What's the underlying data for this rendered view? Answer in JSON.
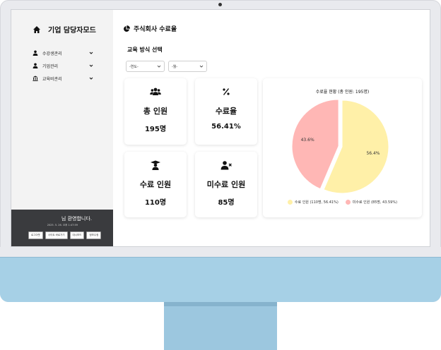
{
  "sidebar": {
    "title": "기업 담당자모드",
    "items": [
      {
        "label": "수강생관리",
        "icon": "user-icon"
      },
      {
        "label": "기업관리",
        "icon": "user-icon"
      },
      {
        "label": "교육비관리",
        "icon": "bank-icon"
      }
    ],
    "welcome": "님 환영합니다.",
    "datetime": "2025. 5. 26. 오후 1:47:59",
    "buttons": [
      "로그아웃",
      "사이트 바로가기",
      "대시보드",
      "정보수정"
    ]
  },
  "main": {
    "title": "주식회사 수료율",
    "section_label": "교육 방식 선택",
    "year_select": "-연도-",
    "month_select": "-월-",
    "cards": [
      {
        "label": "총 인원",
        "value": "195명",
        "icon": "users-icon"
      },
      {
        "label": "수료율",
        "value": "56.41%",
        "icon": "percent-icon"
      },
      {
        "label": "수료 인원",
        "value": "110명",
        "icon": "graduate-icon"
      },
      {
        "label": "미수료 인원",
        "value": "85명",
        "icon": "user-x-icon"
      }
    ]
  },
  "chart_data": {
    "type": "pie",
    "title": "수료율 현황 (총 인원: 195명)",
    "categories": [
      "수료 인원 (110명, 56.41%)",
      "미수료 인원 (85명, 43.59%)"
    ],
    "values": [
      110,
      85
    ],
    "data_labels": [
      "56.4%",
      "43.6%"
    ],
    "colors": [
      "#fff0a8",
      "#ffb7b5"
    ],
    "legend_position": "bottom"
  },
  "colors": {
    "sidebar_bg": "#f3f3f3",
    "sidebar_bottom_bg": "#3a3b3e",
    "monitor_chin": "#a6d0e6"
  }
}
